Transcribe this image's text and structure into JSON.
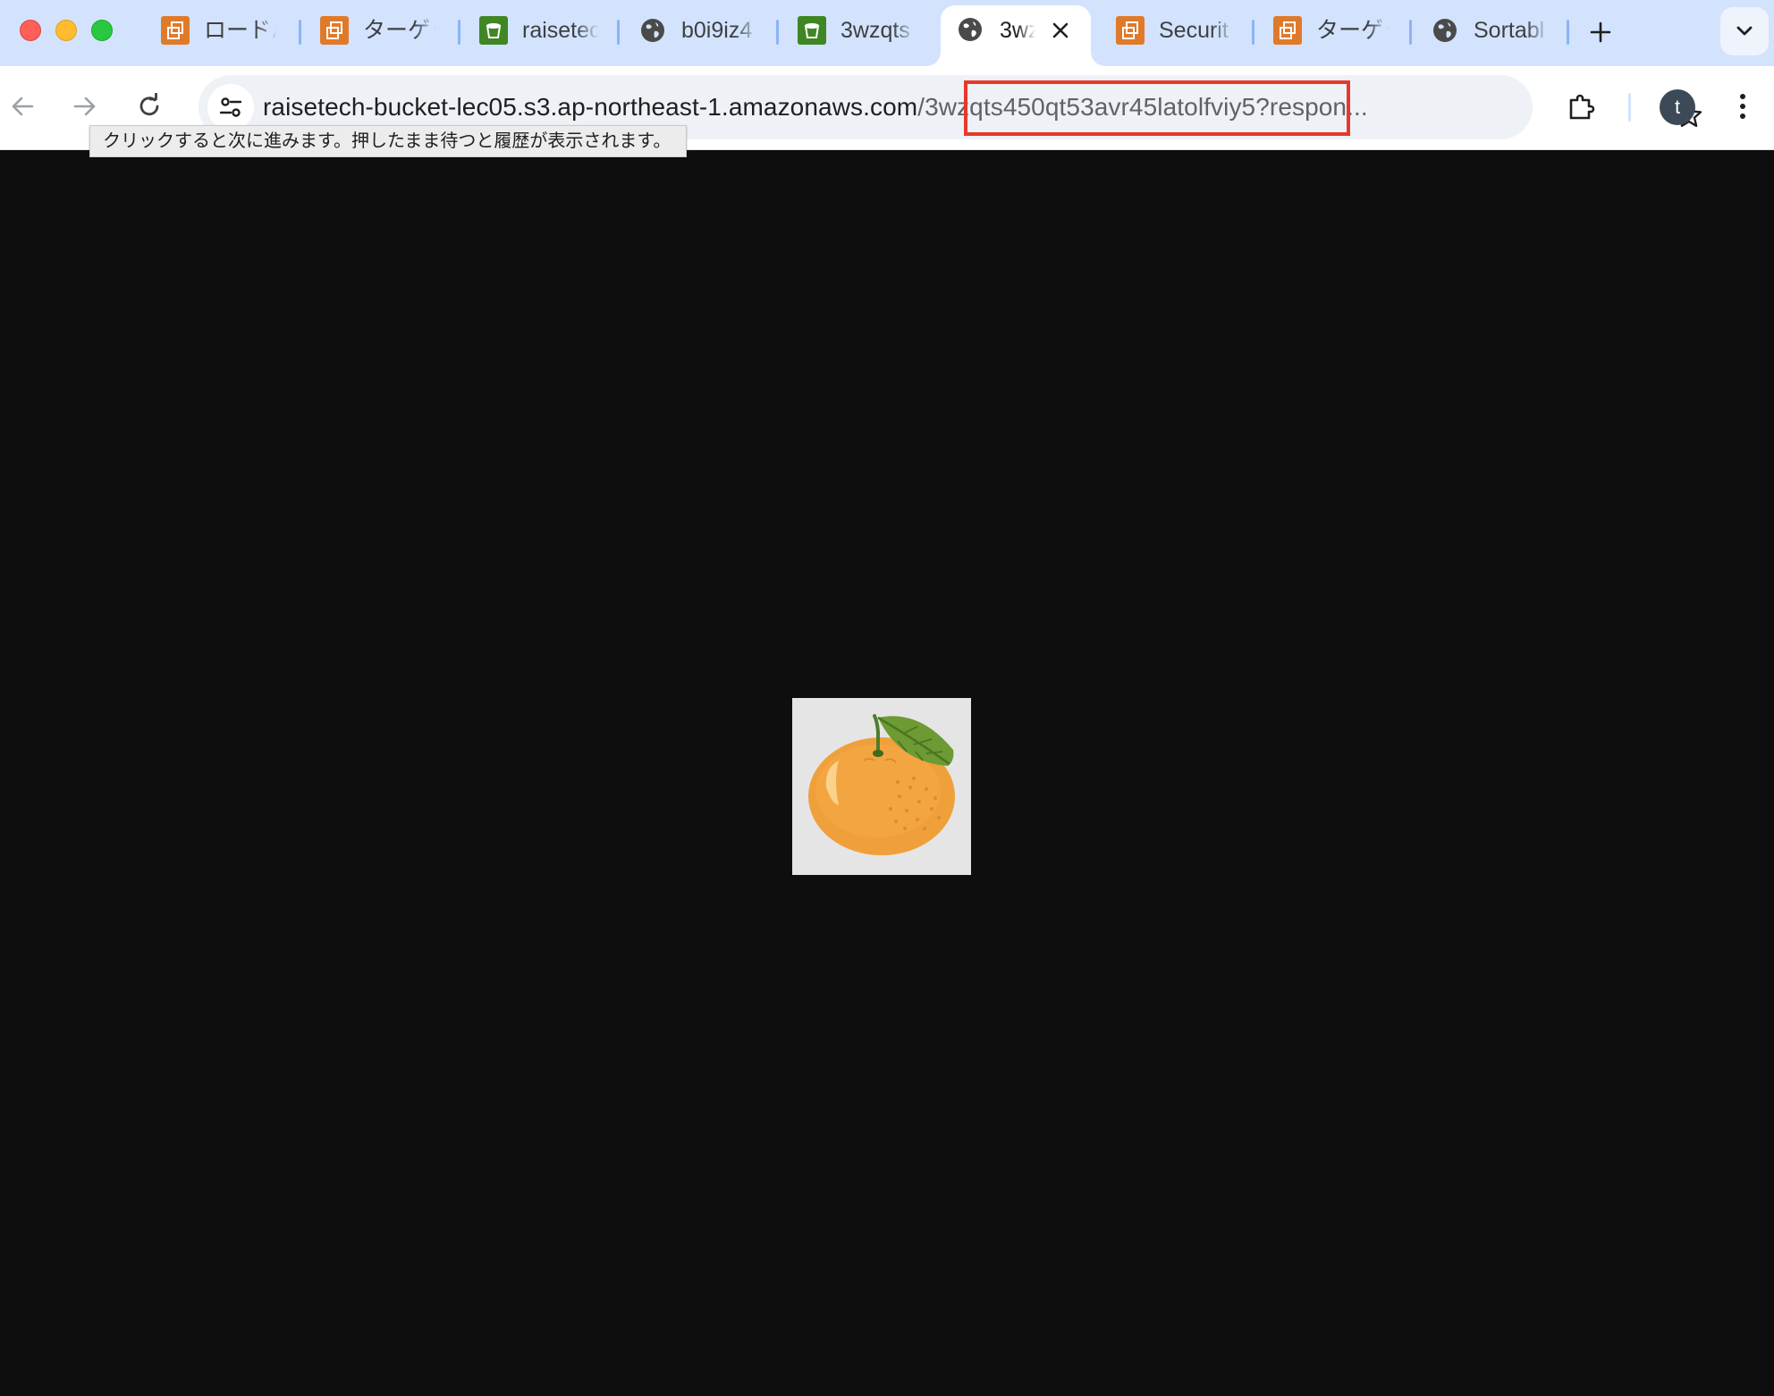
{
  "browser": {
    "tabs": [
      {
        "label": "ロードバ",
        "icon": "aws-ec2-icon"
      },
      {
        "label": "ターゲッ",
        "icon": "aws-ec2-icon"
      },
      {
        "label": "raisetec",
        "icon": "aws-s3-icon"
      },
      {
        "label": "b0i9iz4",
        "icon": "globe-icon"
      },
      {
        "label": "3wzqts",
        "icon": "aws-s3-icon"
      },
      {
        "label": "3wz",
        "icon": "globe-icon",
        "active": true
      },
      {
        "label": "Securit",
        "icon": "aws-ec2-icon"
      },
      {
        "label": "ターゲッ",
        "icon": "aws-ec2-icon"
      },
      {
        "label": "Sortabl",
        "icon": "globe-icon"
      }
    ],
    "address_bar": {
      "host": "raisetech-bucket-lec05.s3.ap-northeast-1.amazonaws.com",
      "path": "/3wzqts450qt53avr45latolfviy5?",
      "rest": "respon..."
    },
    "tooltip": "クリックすると次に進みます。押したまま待つと履歴が表示されます。",
    "profile_initial": "t"
  },
  "colors": {
    "tabstrip_bg": "#d3e3fd",
    "highlight_box": "#e8382a",
    "page_bg": "#0e0e0e",
    "aws_orange": "#e07a2b",
    "aws_green": "#3f8624"
  },
  "content": {
    "image": "tangerine-with-leaf-illustration"
  }
}
